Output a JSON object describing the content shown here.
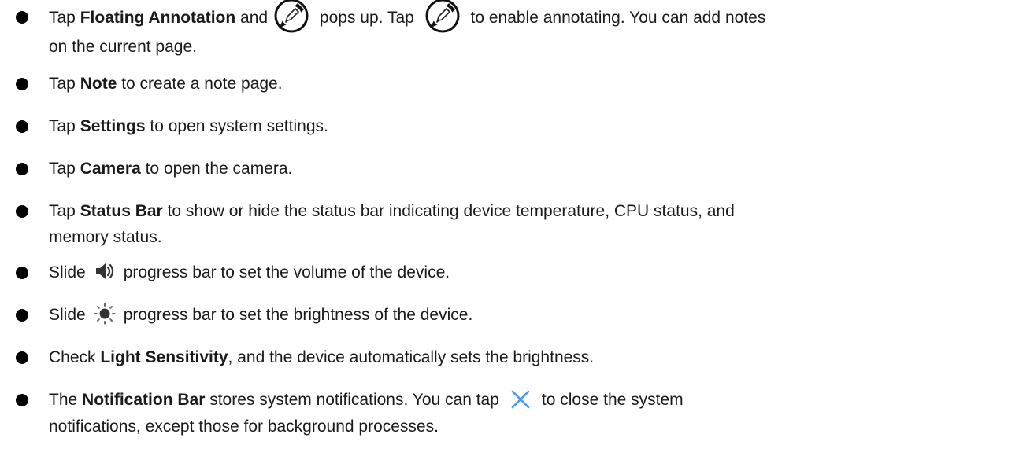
{
  "items": [
    {
      "t0": "Tap ",
      "b0": "Floating Annotation",
      "t1": " and",
      "t2": " pops up. Tap ",
      "t3": " to enable annotating. You can add notes",
      "line2": "on the current page.",
      "icon": "floating-annotation-pen-icon"
    },
    {
      "t0": "Tap ",
      "b0": "Note",
      "t1": " to create a note page."
    },
    {
      "t0": "Tap ",
      "b0": "Settings",
      "t1": " to open system settings."
    },
    {
      "t0": "Tap ",
      "b0": "Camera",
      "t1": " to open the camera."
    },
    {
      "t0": "Tap ",
      "b0": "Status Bar",
      "t1": " to show or hide the status bar indicating device temperature, CPU status, and",
      "line2": "memory status."
    },
    {
      "t0": "Slide",
      "t1": "progress bar to set the volume of the device.",
      "icon": "volume-icon"
    },
    {
      "t0": "Slide",
      "t1": "progress bar to set the brightness of the device.",
      "icon": "brightness-icon"
    },
    {
      "t0": "Check ",
      "b0": "Light Sensitivity",
      "t1": ", and the device automatically sets the brightness."
    },
    {
      "t0": "The ",
      "b0": "Notification Bar",
      "t1": " stores system notifications. You can tap",
      "t2": "to close the system",
      "line2": "notifications, except those for background processes.",
      "icon": "close-icon"
    }
  ],
  "colors": {
    "text": "#1a1a1a",
    "bullet": "#000000",
    "close_icon": "#4a9be8"
  }
}
